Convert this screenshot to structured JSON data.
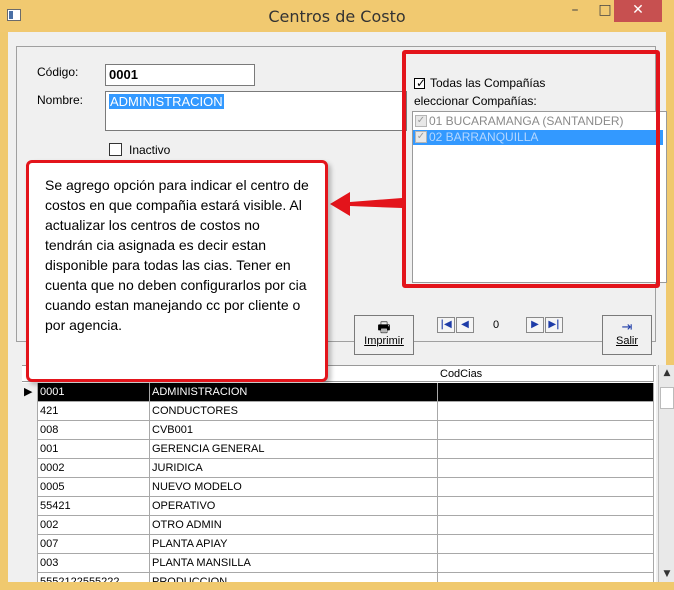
{
  "window": {
    "title": "Centros de Costo",
    "min_glyph": "–",
    "max_glyph": "□",
    "close_glyph": "✕"
  },
  "form": {
    "codigo_label": "Código:",
    "codigo_value": "0001",
    "nombre_label": "Nombre:",
    "nombre_value": "ADMINISTRACION",
    "inactivo_label": "Inactivo",
    "inactivo_checked": false
  },
  "companies": {
    "todas_label": "Todas las Compañías",
    "todas_checked": true,
    "seleccionar_label": "eleccionar Compañías:",
    "items": [
      {
        "label": "01 BUCARAMANGA  (SANTANDER)",
        "checked": true
      },
      {
        "label": "02 BARRANQUILLA",
        "checked": true,
        "highlighted": true
      }
    ]
  },
  "callout": {
    "text": "Se agrego opción para indicar el centro de costos en que compañia estará visible. Al actualizar los centros de costos no tendrán cia asignada es decir estan disponible para todas las cias. Tener en cuenta que no deben configurarlos por cia cuando estan manejando cc por cliente o por agencia."
  },
  "toolbar": {
    "imprimir_label": "Imprimir",
    "salir_label": "Salir",
    "record_number": "0",
    "first_glyph": "|◀",
    "prev_glyph": "◀",
    "next_glyph": "▶",
    "last_glyph": "▶|"
  },
  "grid": {
    "columns": [
      "",
      "",
      "",
      "CodCias"
    ],
    "rows": [
      {
        "code": "0001",
        "name": "ADMINISTRACION",
        "codcias": "",
        "selected": true
      },
      {
        "code": "421",
        "name": "CONDUCTORES",
        "codcias": ""
      },
      {
        "code": "008",
        "name": "CVB001",
        "codcias": ""
      },
      {
        "code": "001",
        "name": "GERENCIA GENERAL",
        "codcias": ""
      },
      {
        "code": "0002",
        "name": "JURIDICA",
        "codcias": ""
      },
      {
        "code": "0005",
        "name": "NUEVO MODELO",
        "codcias": ""
      },
      {
        "code": "55421",
        "name": "OPERATIVO",
        "codcias": ""
      },
      {
        "code": "002",
        "name": "OTRO ADMIN",
        "codcias": ""
      },
      {
        "code": "007",
        "name": "PLANTA APIAY",
        "codcias": ""
      },
      {
        "code": "003",
        "name": "PLANTA MANSILLA",
        "codcias": ""
      },
      {
        "code": "5552122555222",
        "name": "PRODUCCION",
        "codcias": ""
      }
    ]
  },
  "colors": {
    "highlight_red": "#e3141b",
    "selection_blue": "#3399ff",
    "title_bar": "#f1c970"
  }
}
